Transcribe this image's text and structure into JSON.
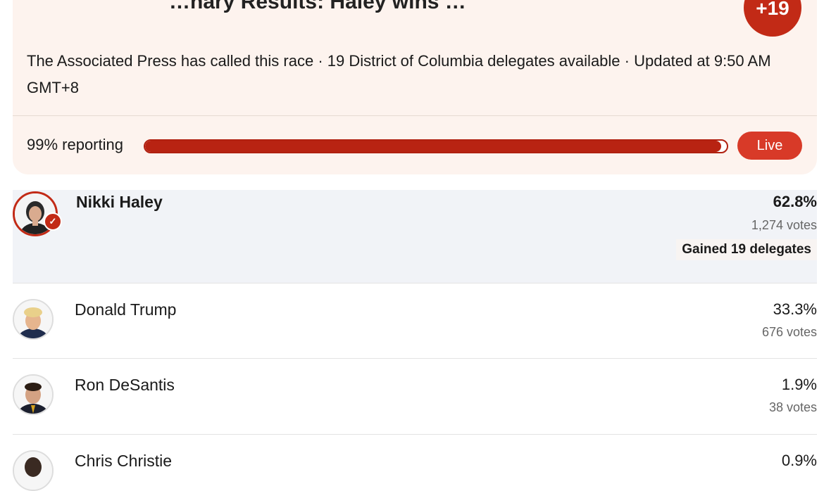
{
  "race": {
    "heading_partial": "…nary Results: Haley wins …",
    "delegate_badge": "+19",
    "status_line": "The Associated Press has called this race · 19 District of Columbia delegates available · Updated at 9:50 AM GMT+8",
    "reporting_label": "99% reporting",
    "reporting_progress": 0.99,
    "live_label": "Live"
  },
  "candidates": [
    {
      "name": "Nikki Haley",
      "pct": "62.8%",
      "votes": "1,274 votes",
      "gained": "Gained 19 delegates",
      "winner": true
    },
    {
      "name": "Donald Trump",
      "pct": "33.3%",
      "votes": "676 votes"
    },
    {
      "name": "Ron DeSantis",
      "pct": "1.9%",
      "votes": "38 votes"
    },
    {
      "name": "Chris Christie",
      "pct": "0.9%"
    }
  ],
  "colors": {
    "accent": "#c22a16",
    "card_bg": "#fdf3ee",
    "winner_row_bg": "#f1f3f7"
  },
  "icons": [
    "check-icon",
    "candidate-photo"
  ]
}
